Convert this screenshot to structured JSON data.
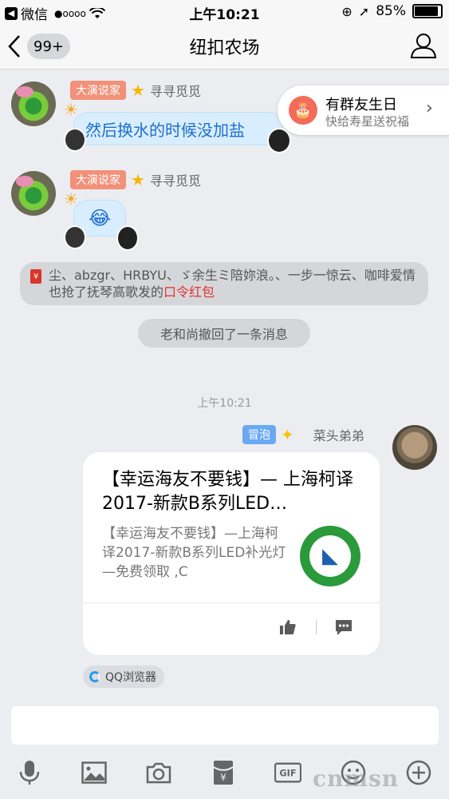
{
  "status_bar": {
    "carrier": "微信",
    "signal": "●oooo",
    "time": "上午10:21",
    "battery": "85%"
  },
  "nav": {
    "badge": "99+",
    "title": "纽扣农场"
  },
  "messages": [
    {
      "tag": "大演说家",
      "sender": "寻寻觅觅",
      "text": "然后换水的时候没加盐"
    },
    {
      "tag": "大演说家",
      "sender": "寻寻觅觅",
      "text": "😂"
    }
  ],
  "birthday": {
    "title": "有群友生日",
    "subtitle": "快给寿星送祝福"
  },
  "notice_redpacket": {
    "text": "尘、abzgr、HRBYU、ゞ余生ミ陪妳浪。、一步一惊云、咖啡爱情也抢了抚琴高歌发的",
    "highlight": "口令红包"
  },
  "notice_recall": "老和尚撤回了一条消息",
  "timestamp": "上午10:21",
  "my_message": {
    "tag": "冒泡",
    "sender": "菜头弟弟",
    "card_title": "【幸运海友不要钱】— 上海柯译2017-新款B系列LED…",
    "card_desc": "【幸运海友不要钱】—上海柯译2017-新款B系列LED补光灯—免费领取 ,C",
    "source": "QQ浏览器"
  },
  "toolbar_icons": [
    "mic-icon",
    "image-icon",
    "camera-icon",
    "redpacket-icon",
    "gif-icon",
    "emoji-icon",
    "plus-icon"
  ],
  "watermark": "cnmsn"
}
